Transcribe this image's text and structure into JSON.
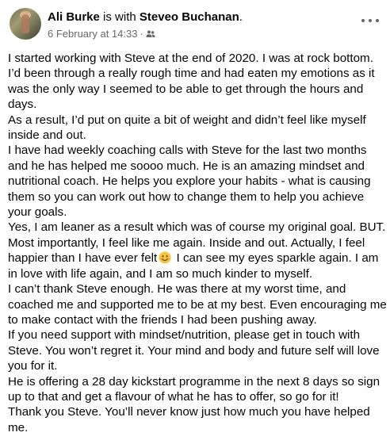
{
  "author": {
    "name": "Ali Burke",
    "with_word": "is with",
    "tagged": "Steveo Buchanan",
    "tagged_suffix": "."
  },
  "meta": {
    "date": "6 February at 14:33",
    "separator": "·",
    "audience_icon": "friends-icon"
  },
  "more_icon": "ellipsis-icon",
  "post": {
    "p1": "I started working with Steve at the end of 2020. I was at rock bottom. I’d been through a really rough time and had eaten my emotions as it was the only way I seemed to be able to get through the hours and days.",
    "p2": "As a result, I’d put on quite a bit of weight and didn’t feel like myself inside and out.",
    "p3": "I have had weekly coaching calls with Steve for the last two months and he has helped me soooo much. He is an amazing mindset and nutritional coach. He helps you explore your habits - what is causing them so you can work out how to change them to help you achieve your goals.",
    "p4": "Yes, I am leaner as a result which was of course my original goal. BUT. Most importantly, I feel like me again. Inside and out. Actually, I feel happier than I have ever felt",
    "p4_emoji": "smiling-face-emoji",
    "p4_after": "I can see my eyes sparkle again. I am in love with life again, and I am so much kinder to myself.",
    "p5": "I can’t thank Steve enough. He was there at my worst time, and coached me and supported me to be at my best. Even encouraging me to make contact with the friends I had been pushing away.",
    "p6": "If you need support with mindset/nutrition, please get in touch with Steve. You won’t regret it. Your mind and body and future self will love you for it.",
    "p7": "He is offering a 28 day kickstart programme in the next 8 days so sign up to that and get a flavour of what he has to offer, so go for it!",
    "p8": "Thank you Steve. You’ll never know just how much you have helped me."
  },
  "colors": {
    "text": "#050505",
    "secondary": "#65676b",
    "emoji_face": "#f7c33a"
  }
}
